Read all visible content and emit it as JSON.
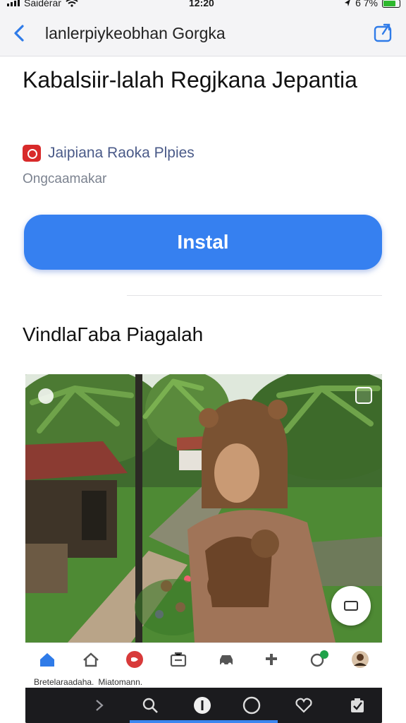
{
  "status_bar": {
    "carrier": "Saidérar",
    "time": "12:20",
    "battery_text": "6 7%"
  },
  "nav": {
    "title": "lanlerpiykeobhan Gorgka",
    "back_icon": "chevron-left-icon",
    "share_icon": "share-icon"
  },
  "app": {
    "title": "Kabalsiir-lalah Regjkana Jepantia",
    "developer": "Jaipiana Raoka Plpies",
    "category": "Ongcaamakar",
    "install_label": "Instal"
  },
  "preview": {
    "section_title": "VindlaΓaba Piagalah",
    "caption_left": "Bretelaraadaha.",
    "caption_right": "Miatomann.",
    "tab_icons": [
      "home-icon",
      "house-icon",
      "heart-badge-icon",
      "store-icon",
      "car-icon",
      "puzzle-icon",
      "chat-badge-icon",
      "profile-avatar-icon"
    ],
    "dark_icons": [
      "chevron-right-icon",
      "search-icon",
      "info-icon",
      "circle-icon",
      "heart-icon",
      "checkbox-icon"
    ]
  },
  "colors": {
    "accent": "#3680f0",
    "install_text": "#ffffff",
    "developer_text": "#4a5a88",
    "developer_icon": "#d82a2a"
  }
}
